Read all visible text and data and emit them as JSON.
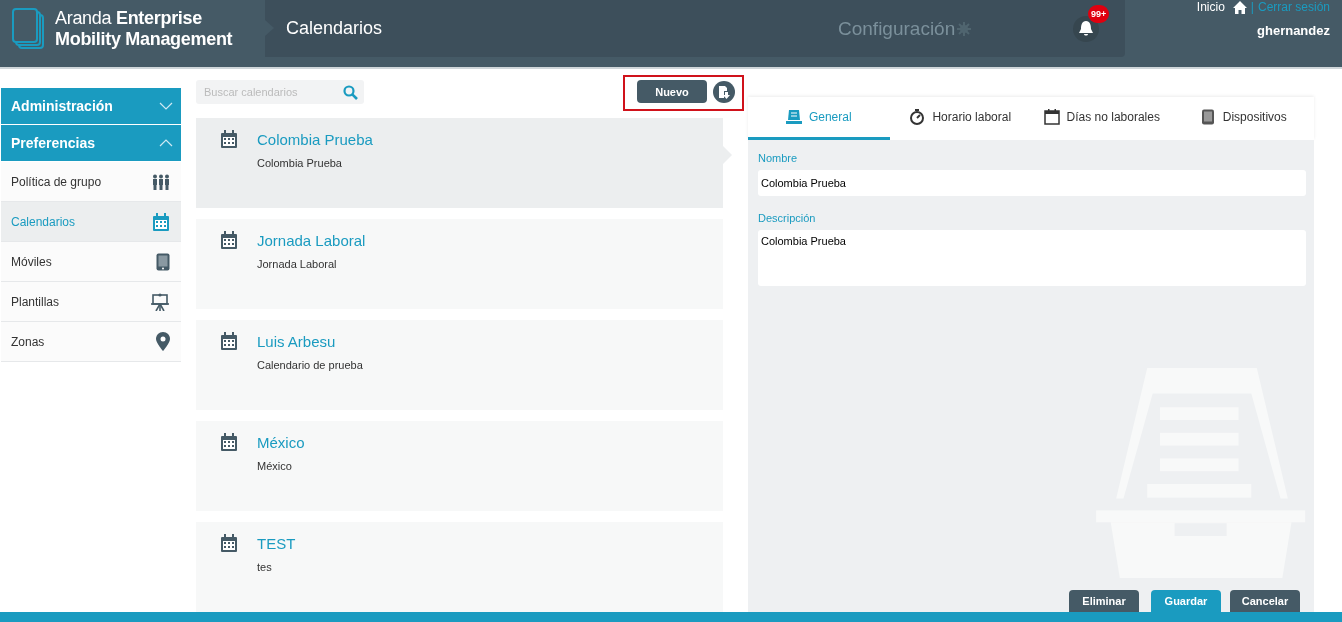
{
  "header": {
    "brand_light": "Aranda",
    "brand_bold": "Enterprise",
    "brand_line2": "Mobility Management",
    "page_title": "Calendarios",
    "config_label": "Configuración",
    "notification_badge": "99+",
    "home_link": "Inicio",
    "separator": "|",
    "logout_link": "Cerrar sesión",
    "username": "ghernandez"
  },
  "sidebar": {
    "sections": [
      {
        "label": "Administración",
        "expanded": false
      },
      {
        "label": "Preferencias",
        "expanded": true,
        "items": [
          {
            "label": "Política de grupo",
            "selected": false
          },
          {
            "label": "Calendarios",
            "selected": true
          },
          {
            "label": "Móviles",
            "selected": false
          },
          {
            "label": "Plantillas",
            "selected": false
          },
          {
            "label": "Zonas",
            "selected": false
          }
        ]
      }
    ]
  },
  "list": {
    "search": {
      "placeholder": "Buscar calendarios"
    },
    "new_button": "Nuevo",
    "toolbar_highlighted": true,
    "items": [
      {
        "title": "Colombia Prueba",
        "description": "Colombia Prueba",
        "selected": true
      },
      {
        "title": "Jornada Laboral",
        "description": "Jornada Laboral",
        "selected": false
      },
      {
        "title": "Luis Arbesu",
        "description": "Calendario de prueba",
        "selected": false
      },
      {
        "title": "México",
        "description": "México",
        "selected": false
      },
      {
        "title": "TEST",
        "description": "tes",
        "selected": false
      }
    ]
  },
  "detail": {
    "tabs": [
      {
        "label": "General",
        "selected": true
      },
      {
        "label": "Horario laboral",
        "selected": false
      },
      {
        "label": "Días no laborales",
        "selected": false
      },
      {
        "label": "Dispositivos",
        "selected": false
      }
    ],
    "fields": [
      {
        "label": "Nombre",
        "value": "Colombia Prueba",
        "kind": "input"
      },
      {
        "label": "Descripción",
        "value": "Colombia Prueba",
        "kind": "textarea"
      }
    ],
    "buttons": [
      {
        "label": "Eliminar",
        "kind": "secondary"
      },
      {
        "label": "Guardar",
        "kind": "primary"
      },
      {
        "label": "Cancelar",
        "kind": "secondary"
      }
    ]
  }
}
